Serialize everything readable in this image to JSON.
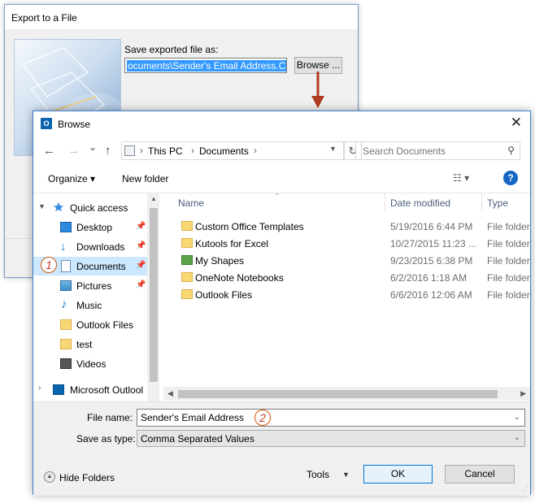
{
  "export_dialog": {
    "title": "Export to a File",
    "save_label": "Save exported file as:",
    "path_value": "ocuments\\Sender's Email Address.CSV",
    "browse_label": "Browse ..."
  },
  "browse_dialog": {
    "title": "Browse",
    "app_icon_text": "O",
    "close_glyph": "✕",
    "nav": {
      "back_glyph": "←",
      "forward_glyph": "→",
      "recent_glyph": "⌄",
      "up_glyph": "↑",
      "breadcrumb": [
        "This PC",
        "Documents"
      ],
      "refresh_glyph": "↻",
      "search_placeholder": "Search Documents"
    },
    "toolbar": {
      "organize": "Organize ▾",
      "new_folder": "New folder",
      "views_glyph": "☷ ▾",
      "help": "?"
    },
    "nav_pane": [
      {
        "label": "Quick access",
        "icon": "star-icon",
        "expanded": true
      },
      {
        "label": "Desktop",
        "icon": "desktop-icon",
        "pinned": true
      },
      {
        "label": "Downloads",
        "icon": "download-icon",
        "pinned": true
      },
      {
        "label": "Documents",
        "icon": "document-icon",
        "pinned": true,
        "selected": true
      },
      {
        "label": "Pictures",
        "icon": "pictures-icon",
        "pinned": true
      },
      {
        "label": "Music",
        "icon": "music-icon"
      },
      {
        "label": "Outlook Files",
        "icon": "folder-icon"
      },
      {
        "label": "test",
        "icon": "folder-icon"
      },
      {
        "label": "Videos",
        "icon": "video-icon"
      },
      {
        "label": "Microsoft Outlool",
        "icon": "outlook-icon"
      }
    ],
    "columns": {
      "name": "Name",
      "date": "Date modified",
      "type": "Type"
    },
    "files": [
      {
        "name": "Custom Office Templates",
        "date": "5/19/2016 6:44 PM",
        "type": "File folder"
      },
      {
        "name": "Kutools for Excel",
        "date": "10/27/2015 11:23 ...",
        "type": "File folder"
      },
      {
        "name": "My Shapes",
        "date": "9/23/2015 6:38 PM",
        "type": "File folder"
      },
      {
        "name": "OneNote Notebooks",
        "date": "6/2/2016 1:18 AM",
        "type": "File folder"
      },
      {
        "name": "Outlook Files",
        "date": "6/6/2016 12:06 AM",
        "type": "File folder"
      }
    ],
    "bottom": {
      "file_name_label": "File name:",
      "file_name_value": "Sender's Email Address",
      "save_type_label": "Save as type:",
      "save_type_value": "Comma Separated Values",
      "hide_folders": "Hide Folders",
      "tools": "Tools",
      "ok": "OK",
      "cancel": "Cancel"
    }
  },
  "annotations": {
    "step1": "1",
    "step2": "2"
  },
  "colors": {
    "accent": "#0078d7",
    "arrow": "#b03a1e",
    "selection": "#cce8ff"
  }
}
